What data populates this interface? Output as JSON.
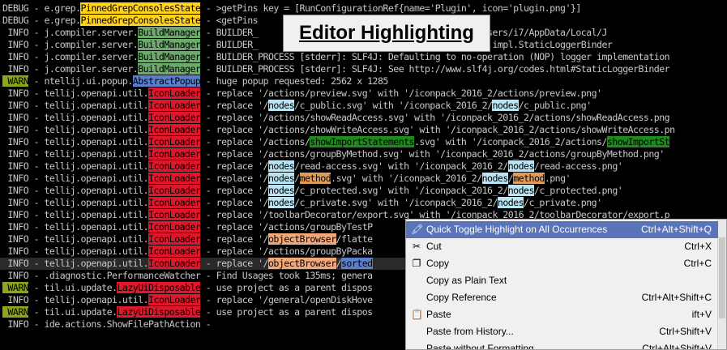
{
  "title_overlay": "Editor Highlighting",
  "console_lines": [
    [
      {
        "t": "DEBUG - e.grep."
      },
      {
        "t": "PinnedGrepConsolesState",
        "c": "hl-yellow"
      },
      {
        "t": " - >getPins key = [RunConfigurationRef{name='Plugin', icon='plugin.png'}]"
      }
    ],
    [
      {
        "t": "DEBUG - e.grep."
      },
      {
        "t": "PinnedGrepConsolesState",
        "c": "hl-yellow"
      },
      {
        "t": " - <getPins"
      }
    ],
    [
      {
        "t": " INFO - j.compiler.server."
      },
      {
        "t": "BuildManager",
        "c": "hl-green"
      },
      {
        "t": " - BUILDER_                         ed. Classpath: C:/Users/i7/AppData/Local/J"
      }
    ],
    [
      {
        "t": " INFO - j.compiler.server."
      },
      {
        "t": "BuildManager",
        "c": "hl-green"
      },
      {
        "t": " - BUILDER_                         ad class \"org.slf4j.impl.StaticLoggerBinder"
      }
    ],
    [
      {
        "t": " INFO - j.compiler.server."
      },
      {
        "t": "BuildManager",
        "c": "hl-green"
      },
      {
        "t": " - BUILDER_PROCESS [stderr]: SLF4J: Defaulting to no-operation (NOP) logger implementation"
      }
    ],
    [
      {
        "t": " INFO - j.compiler.server."
      },
      {
        "t": "BuildManager",
        "c": "hl-green"
      },
      {
        "t": " - BUILDER_PROCESS [stderr]: SLF4J: See http://www.slf4j.org/codes.html#StaticLoggerBinder"
      }
    ],
    [
      {
        "t": " WARN",
        "c": "lvl-warn"
      },
      {
        "t": " - ntellij.ui.popup."
      },
      {
        "t": "AbstractPopup",
        "c": "hl-blue"
      },
      {
        "t": " - huge popup requested: 2562 x 1285"
      }
    ],
    [
      {
        "t": " INFO - tellij.openapi.util."
      },
      {
        "t": "IconLoader",
        "c": "hl-red"
      },
      {
        "t": " - replace '/actions/preview.svg' with '/iconpack_2016_2/actions/preview.png'"
      }
    ],
    [
      {
        "t": " INFO - tellij.openapi.util."
      },
      {
        "t": "IconLoader",
        "c": "hl-red"
      },
      {
        "t": " - replace '/"
      },
      {
        "t": "nodes",
        "c": "hl-cyan"
      },
      {
        "t": "/c_public.svg' with '/iconpack_2016_2/"
      },
      {
        "t": "nodes",
        "c": "hl-cyan"
      },
      {
        "t": "/c_public.png'"
      }
    ],
    [
      {
        "t": " INFO - tellij.openapi.util."
      },
      {
        "t": "IconLoader",
        "c": "hl-red"
      },
      {
        "t": " - replace '/actions/showReadAccess.svg' with '/iconpack_2016_2/actions/showReadAccess.png"
      }
    ],
    [
      {
        "t": " INFO - tellij.openapi.util."
      },
      {
        "t": "IconLoader",
        "c": "hl-red"
      },
      {
        "t": " - replace '/actions/showWriteAccess.svg' with '/iconpack_2016_2/actions/showWriteAccess.pn"
      }
    ],
    [
      {
        "t": " INFO - tellij.openapi.util."
      },
      {
        "t": "IconLoader",
        "c": "hl-red"
      },
      {
        "t": " - replace '/actions/"
      },
      {
        "t": "showImportStatements",
        "c": "hl-darkgreen"
      },
      {
        "t": ".svg' with '/iconpack_2016_2/actions/"
      },
      {
        "t": "showImportSt",
        "c": "hl-darkgreen"
      }
    ],
    [
      {
        "t": " INFO - tellij.openapi.util."
      },
      {
        "t": "IconLoader",
        "c": "hl-red"
      },
      {
        "t": " - replace '/actions/groupByMethod.svg' with '/iconpack_2016_2/actions/groupByMethod.png'"
      }
    ],
    [
      {
        "t": " INFO - tellij.openapi.util."
      },
      {
        "t": "IconLoader",
        "c": "hl-red"
      },
      {
        "t": " - replace '/"
      },
      {
        "t": "nodes",
        "c": "hl-cyan"
      },
      {
        "t": "/read-access.svg' with '/iconpack_2016_2/"
      },
      {
        "t": "nodes",
        "c": "hl-cyan"
      },
      {
        "t": "/read-access.png'"
      }
    ],
    [
      {
        "t": " INFO - tellij.openapi.util."
      },
      {
        "t": "IconLoader",
        "c": "hl-red"
      },
      {
        "t": " - replace '/"
      },
      {
        "t": "nodes",
        "c": "hl-cyan"
      },
      {
        "t": "/"
      },
      {
        "t": "method",
        "c": "hl-orange"
      },
      {
        "t": ".svg' with '/iconpack_2016_2/"
      },
      {
        "t": "nodes",
        "c": "hl-cyan"
      },
      {
        "t": "/"
      },
      {
        "t": "method",
        "c": "hl-orange"
      },
      {
        "t": ".png'"
      }
    ],
    [
      {
        "t": " INFO - tellij.openapi.util."
      },
      {
        "t": "IconLoader",
        "c": "hl-red"
      },
      {
        "t": " - replace '/"
      },
      {
        "t": "nodes",
        "c": "hl-cyan"
      },
      {
        "t": "/c_protected.svg' with '/iconpack_2016_2/"
      },
      {
        "t": "nodes",
        "c": "hl-cyan"
      },
      {
        "t": "/c_protected.png'"
      }
    ],
    [
      {
        "t": " INFO - tellij.openapi.util."
      },
      {
        "t": "IconLoader",
        "c": "hl-red"
      },
      {
        "t": " - replace '/"
      },
      {
        "t": "nodes",
        "c": "hl-cyan"
      },
      {
        "t": "/c_private.svg' with '/iconpack_2016_2/"
      },
      {
        "t": "nodes",
        "c": "hl-cyan"
      },
      {
        "t": "/c_private.png'"
      }
    ],
    [
      {
        "t": " INFO - tellij.openapi.util."
      },
      {
        "t": "IconLoader",
        "c": "hl-red"
      },
      {
        "t": " - replace '/toolbarDecorator/export.svg' with '/iconpack_2016_2/toolbarDecorator/export.p"
      }
    ],
    [
      {
        "t": " INFO - tellij.openapi.util."
      },
      {
        "t": "IconLoader",
        "c": "hl-red"
      },
      {
        "t": " - replace '/actions/groupByTestP"
      }
    ],
    [
      {
        "t": " INFO - tellij.openapi.util."
      },
      {
        "t": "IconLoader",
        "c": "hl-red"
      },
      {
        "t": " - replace '/"
      },
      {
        "t": "objectBrowser",
        "c": "hl-peach"
      },
      {
        "t": "/flatte"
      }
    ],
    [
      {
        "t": " INFO - tellij.openapi.util."
      },
      {
        "t": "IconLoader",
        "c": "hl-red"
      },
      {
        "t": " - replace '/actions/groupByPacka"
      }
    ],
    [
      {
        "t": " INFO - tellij.openapi.util."
      },
      {
        "t": "IconLoader",
        "c": "hl-red"
      },
      {
        "t": " - replace '/"
      },
      {
        "t": "objectBrowser",
        "c": "hl-peach"
      },
      {
        "t": "/"
      },
      {
        "t": "sorted",
        "c": "hl-blue"
      }
    ],
    [
      {
        "t": " INFO - .diagnostic.PerformanceWatcher - Find Usages took 135ms; genera"
      }
    ],
    [
      {
        "t": " WARN",
        "c": "lvl-warn"
      },
      {
        "t": " - til.ui.update."
      },
      {
        "t": "LazyUiDisposable",
        "c": "hl-red"
      },
      {
        "t": " - use project as a parent dispos"
      }
    ],
    [
      {
        "t": " INFO - tellij.openapi.util."
      },
      {
        "t": "IconLoader",
        "c": "hl-red"
      },
      {
        "t": " - replace '/general/openDiskHove"
      }
    ],
    [
      {
        "t": " WARN",
        "c": "lvl-warn"
      },
      {
        "t": " - til.ui.update."
      },
      {
        "t": "LazyUiDisposable",
        "c": "hl-red"
      },
      {
        "t": " - use project as a parent dispos"
      }
    ],
    [
      {
        "t": " INFO - ide.actions.ShowFilePathAction -"
      }
    ]
  ],
  "context_menu": {
    "items": [
      {
        "label": "Quick Toggle Highlight on All Occurrences",
        "shortcut": "Ctrl+Alt+Shift+Q",
        "icon": "highlighter-icon",
        "glyph": "🖍",
        "active": true
      },
      {
        "label": "Cut",
        "shortcut": "Ctrl+X",
        "icon": "scissors-icon",
        "glyph": "✂",
        "active": false
      },
      {
        "label": "Copy",
        "shortcut": "Ctrl+C",
        "icon": "copy-icon",
        "glyph": "❐",
        "active": false
      },
      {
        "label": "Copy as Plain Text",
        "shortcut": "",
        "icon": "",
        "glyph": "",
        "active": false
      },
      {
        "label": "Copy Reference",
        "shortcut": "Ctrl+Alt+Shift+C",
        "icon": "",
        "glyph": "",
        "active": false
      },
      {
        "label": "Paste",
        "shortcut": "ift+V",
        "icon": "paste-icon",
        "glyph": "📋",
        "active": false
      },
      {
        "label": "Paste from History...",
        "shortcut": "Ctrl+Shift+V",
        "icon": "",
        "glyph": "",
        "active": false
      },
      {
        "label": "Paste without Formatting",
        "shortcut": "Ctrl+Alt+Shift+V",
        "icon": "",
        "glyph": "",
        "active": false
      }
    ]
  }
}
